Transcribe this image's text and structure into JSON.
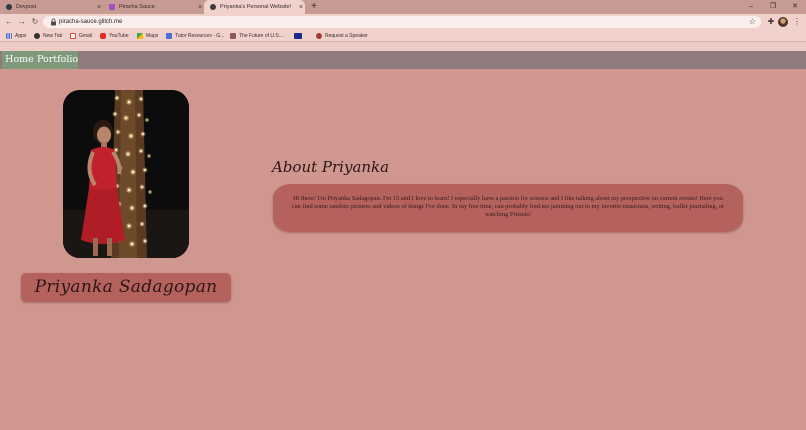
{
  "browser": {
    "tabs": [
      {
        "title": "Devpost",
        "active": false
      },
      {
        "title": "Piracha Sauce",
        "active": false
      },
      {
        "title": "Priyanka's Personal Website!",
        "active": true
      }
    ],
    "new_tab": "+",
    "window_controls": {
      "minimize": "–",
      "maximize": "❐",
      "close": "✕"
    },
    "nav": {
      "back": "←",
      "forward": "→",
      "reload": "↻"
    },
    "url": "piracha-sauce.glitch.me",
    "star": "☆",
    "extensions": "✚",
    "menu": "⋮",
    "bookmarks": [
      {
        "label": "Apps",
        "icon": "apps-grid-icon",
        "color": "#4a6fd8"
      },
      {
        "label": "New Tab",
        "icon": "globe-icon",
        "color": "#333333"
      },
      {
        "label": "Gmail",
        "icon": "gmail-icon",
        "color": "#d64537"
      },
      {
        "label": "YouTube",
        "icon": "youtube-icon",
        "color": "#e52d27"
      },
      {
        "label": "Maps",
        "icon": "maps-icon",
        "color": "#34a853"
      },
      {
        "label": "Tutor Resources - G...",
        "icon": "docs-icon",
        "color": "#4a6fd8"
      },
      {
        "label": "The Future of U.S....",
        "icon": "flag-icon",
        "color": "#8a5a56"
      },
      {
        "label": "",
        "icon": "pbs-icon",
        "color": "#1d2a8a"
      },
      {
        "label": "Request a Speaker",
        "icon": "speaker-icon",
        "color": "#a83a36"
      }
    ]
  },
  "site": {
    "nav": {
      "home": "Home",
      "portfolio": "Portfolio"
    },
    "name": "Priyanka Sadagopan",
    "about": {
      "title": "About Priyanka",
      "text": "Hi there! I'm Priyanka Sadagopan. I'm 15 and I love to learn! I especially have a passion for science and I like talking about my perspective on current events! Here you can find some random pictures and videos of things I've done. In my free time, can probably find me jamming out to my favorite musicians, writing, bullet journaling, or watching Friends!"
    },
    "colors": {
      "background": "#d09690",
      "nav_bar": "#8f7b7b",
      "nav_link": "#80997b",
      "card": "#b5625e"
    }
  }
}
